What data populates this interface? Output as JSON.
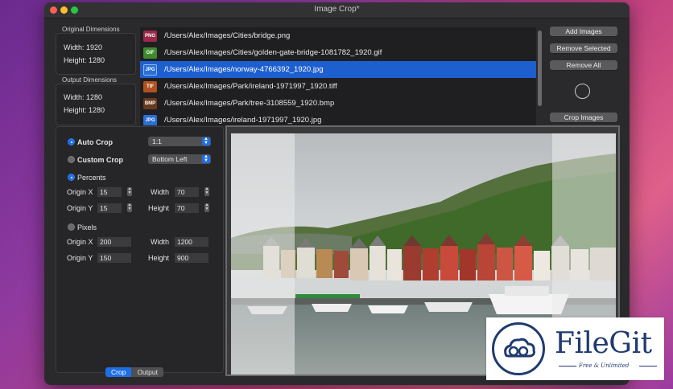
{
  "window": {
    "title": "Image Crop*"
  },
  "original_dimensions": {
    "label": "Original Dimensions",
    "width": "Width: 1920",
    "height": "Height: 1280"
  },
  "output_dimensions": {
    "label": "Output Dimensions",
    "width": "Width: 1280",
    "height": "Height: 1280"
  },
  "files": [
    {
      "type": "PNG",
      "color": "#9b2a4a",
      "path": "/Users/Alex/Images/Cities/bridge.png"
    },
    {
      "type": "GIF",
      "color": "#3d8a2e",
      "path": "/Users/Alex/Images/Cities/golden-gate-bridge-1081782_1920.gif"
    },
    {
      "type": "JPG",
      "color": "#2a6fd6",
      "path": "/Users/Alex/Images/norway-4766392_1920.jpg",
      "selected": true
    },
    {
      "type": "TIF",
      "color": "#b0521f",
      "path": "/Users/Alex/Images/Park/ireland-1971997_1920.tiff"
    },
    {
      "type": "BMP",
      "color": "#6a3a1e",
      "path": "/Users/Alex/Images/Park/tree-3108559_1920.bmp"
    },
    {
      "type": "JPG",
      "color": "#2a6fd6",
      "path": "/Users/Alex/Images/ireland-1971997_1920.jpg"
    }
  ],
  "buttons": {
    "add_images": "Add Images",
    "remove_selected": "Remove Selected",
    "remove_all": "Remove All",
    "crop_images": "Crop Images"
  },
  "crop_settings": {
    "auto_crop": "Auto Crop",
    "custom_crop": "Custom Crop",
    "aspect_value": "1:1",
    "anchor_value": "Bottom Left",
    "percents": "Percents",
    "pixels": "Pixels",
    "origin_x": "Origin X",
    "origin_y": "Origin Y",
    "width": "Width",
    "height": "Height",
    "pct_origin_x": "15",
    "pct_origin_y": "15",
    "pct_width": "70",
    "pct_height": "70",
    "px_origin_x": "200",
    "px_origin_y": "150",
    "px_width": "1200",
    "px_height": "900"
  },
  "tabs": {
    "crop": "Crop",
    "output": "Output"
  },
  "watermark": {
    "title": "FileGit",
    "subtitle": "Free & Unlimited"
  },
  "colors": {
    "accent": "#1e6fe6",
    "selection": "#1e5fd0",
    "brand": "#1f3b70"
  }
}
